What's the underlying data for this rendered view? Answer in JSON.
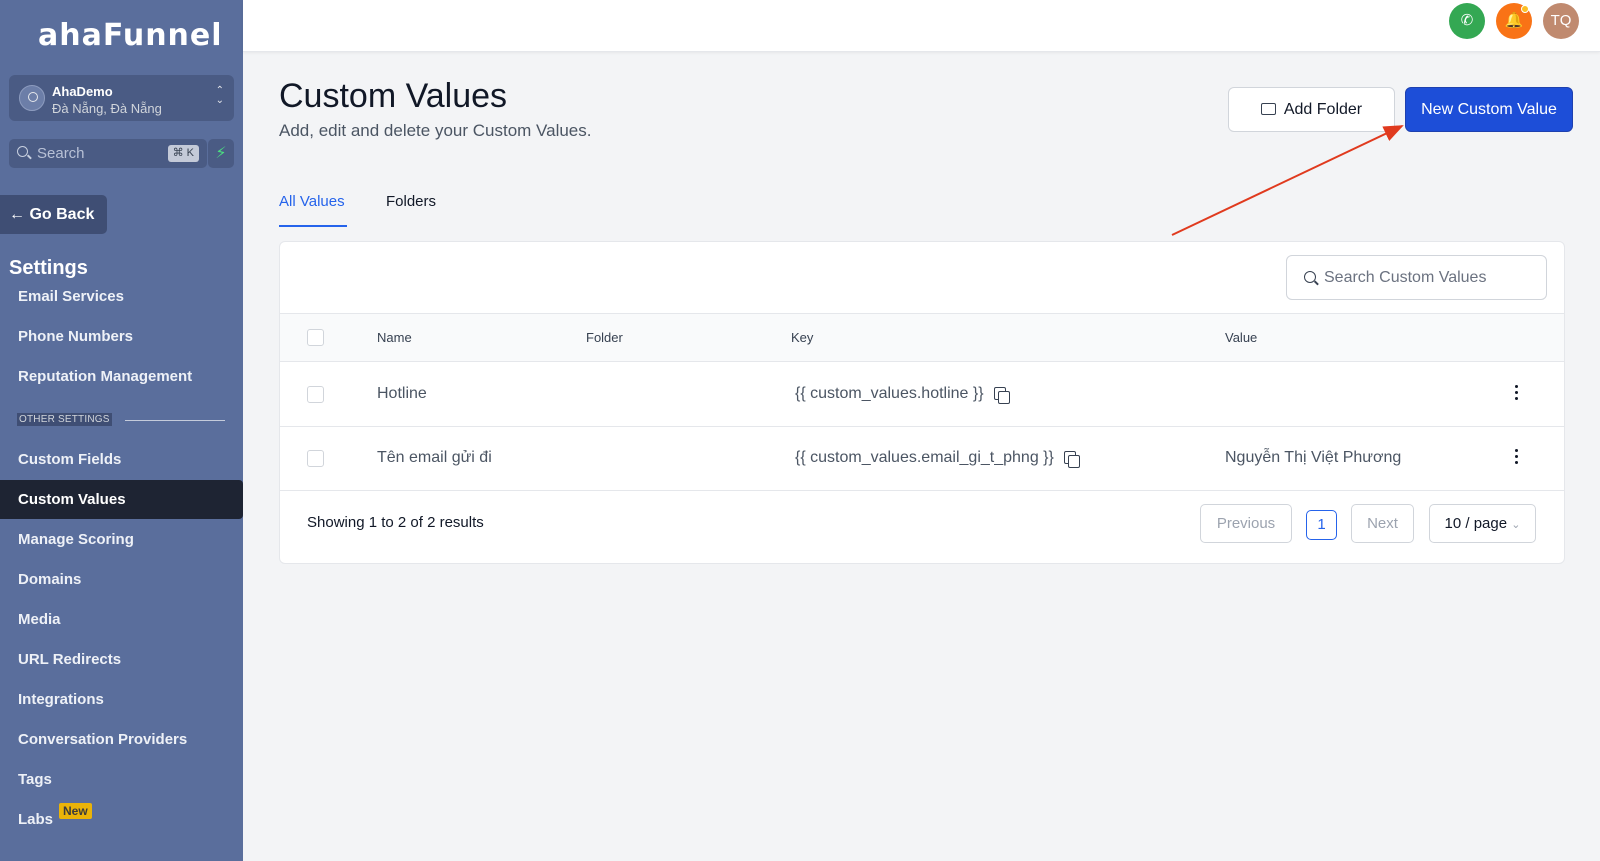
{
  "app": {
    "logo": "ahaFunnel"
  },
  "account": {
    "name": "AhaDemo",
    "location": "Đà Nẵng, Đà Nẵng"
  },
  "sidebar_search": {
    "placeholder": "Search",
    "shortcut": "⌘ K"
  },
  "go_back": "Go Back",
  "settings_title": "Settings",
  "nav_items": [
    "Email Services",
    "Phone Numbers",
    "Reputation Management",
    "Custom Fields",
    "Custom Values",
    "Manage Scoring",
    "Domains",
    "Media",
    "URL Redirects",
    "Integrations",
    "Conversation Providers",
    "Tags",
    "Labs"
  ],
  "other_settings_label": "OTHER SETTINGS",
  "labs_badge": "New",
  "active_nav": "Custom Values",
  "topbar": {
    "avatar_initials": "TQ"
  },
  "page": {
    "title": "Custom Values",
    "subtitle": "Add, edit and delete your Custom Values.",
    "add_folder": "Add Folder",
    "new_value": "New Custom Value"
  },
  "tabs": [
    "All Values",
    "Folders"
  ],
  "table": {
    "search_placeholder": "Search Custom Values",
    "columns": [
      "Name",
      "Folder",
      "Key",
      "Value"
    ],
    "rows": [
      {
        "name": "Hotline",
        "folder": "",
        "key": "{{ custom_values.hotline }}",
        "value": ""
      },
      {
        "name": "Tên email gửi đi",
        "folder": "",
        "key": "{{ custom_values.email_gi_t_phng }}",
        "value": "Nguyễn Thị Việt Phương"
      }
    ],
    "results_text": "Showing 1 to 2 of 2 results",
    "pagination": {
      "previous": "Previous",
      "current_page": "1",
      "next": "Next",
      "page_size": "10 / page"
    }
  },
  "colors": {
    "sidebar": "#5a6e9c",
    "primary": "#1d4ed8",
    "annotation_arrow": "#e03a1e"
  }
}
